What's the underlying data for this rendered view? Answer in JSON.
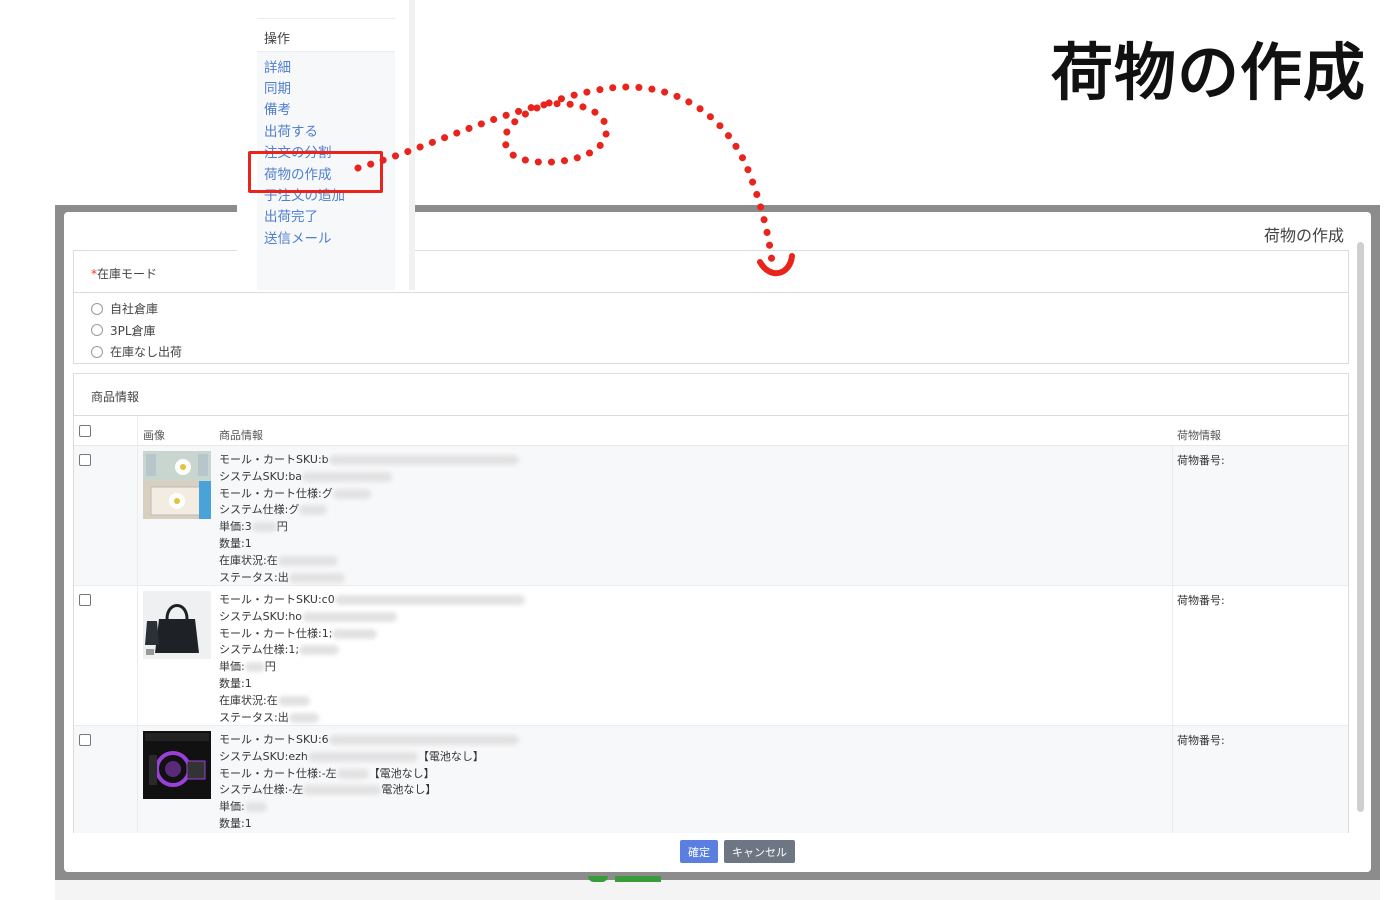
{
  "heading": "荷物の作成",
  "menu": {
    "header": "操作",
    "items": [
      "詳細",
      "同期",
      "備考",
      "出荷する",
      "注文の分割",
      "荷物の作成",
      "子注文の追加",
      "出荷完了",
      "送信メール"
    ]
  },
  "modal": {
    "title": "荷物の作成",
    "stock_mode": {
      "required_mark": "*",
      "label": "在庫モード",
      "options": [
        "自社倉庫",
        "3PL倉庫",
        "在庫なし出荷"
      ]
    },
    "products": {
      "section_label": "商品情報",
      "columns": {
        "image": "画像",
        "info": "商品情報",
        "package": "荷物情報"
      },
      "rows": [
        {
          "lines": [
            "モール・カートSKU:b",
            "システムSKU:ba",
            "モール・カート仕様:グ",
            "システム仕様:グ",
            "単価:3",
            "数量:1",
            "在庫状況:在",
            "ステータス:出"
          ],
          "package_label": "荷物番号:"
        },
        {
          "lines": [
            "モール・カートSKU:c0",
            "システムSKU:ho",
            "モール・カート仕様:1;",
            "システム仕様:1;",
            "単価:",
            "数量:1",
            "在庫状況:在",
            "ステータス:出"
          ],
          "package_label": "荷物番号:"
        },
        {
          "lines": [
            "モール・カートSKU:6",
            "システムSKU:ezh",
            "モール・カート仕様:-左",
            "システム仕様:-左",
            "単価:",
            "数量:1"
          ],
          "package_label": "荷物番号:"
        }
      ],
      "row3_suffixes": [
        "【電池なし】",
        "【電池なし】",
        "電池なし】"
      ],
      "row1_price_suffix": "円",
      "row2_price_suffix": "円"
    },
    "buttons": {
      "confirm": "確定",
      "cancel": "キャンセル"
    }
  },
  "colors": {
    "link": "#4f7fcf",
    "highlight": "#e8241c",
    "confirm": "#5b7fe0",
    "cancel": "#6e7684"
  }
}
